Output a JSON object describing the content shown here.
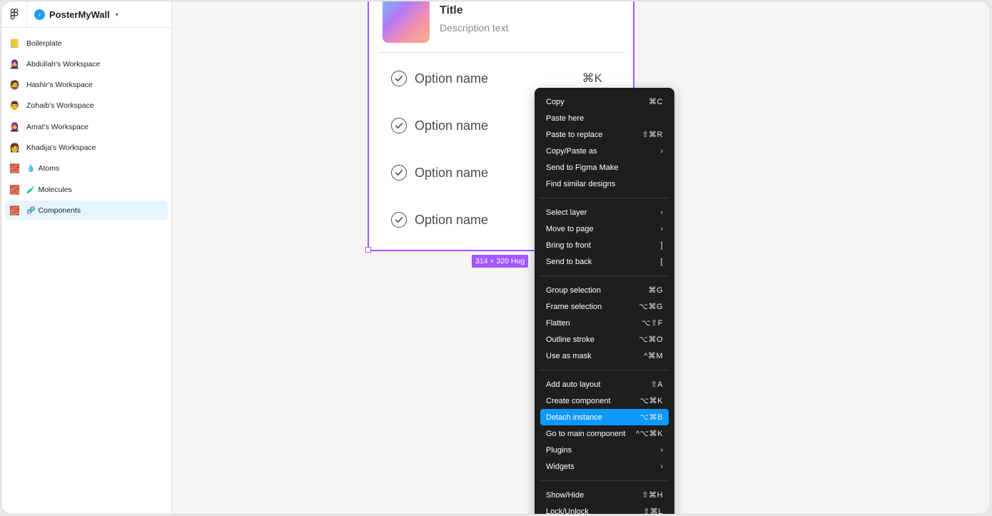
{
  "sidebar": {
    "team_name": "PosterMyWall",
    "items": [
      {
        "icon": "📒",
        "label": "Boilerplate"
      },
      {
        "icon": "🧕",
        "label": "Abdullah's Workspace"
      },
      {
        "icon": "🧔",
        "label": "Hashir's Workspace"
      },
      {
        "icon": "👨",
        "label": "Zohaib's Workspace"
      },
      {
        "icon": "🧕",
        "label": "Amat's Workspace"
      },
      {
        "icon": "👩",
        "label": "Khadija's Workspace"
      },
      {
        "icon": "🧱",
        "sub": "💧",
        "label": "Atoms"
      },
      {
        "icon": "🧱",
        "sub": "🧪",
        "label": "Molecules"
      },
      {
        "icon": "🧱",
        "sub": "🧬",
        "label": "Components"
      }
    ]
  },
  "card": {
    "title": "Title",
    "description": "Description text",
    "options": [
      {
        "label": "Option name",
        "shortcut": "⌘K"
      },
      {
        "label": "Option name",
        "shortcut": ""
      },
      {
        "label": "Option name",
        "shortcut": ""
      },
      {
        "label": "Option name",
        "shortcut": ""
      }
    ]
  },
  "size_badge": "314 × 320 Hug",
  "menu": {
    "items": [
      {
        "label": "Copy",
        "shortcut": "⌘C"
      },
      {
        "label": "Paste here",
        "shortcut": ""
      },
      {
        "label": "Paste to replace",
        "shortcut": "⇧⌘R"
      },
      {
        "label": "Copy/Paste as",
        "shortcut": "›"
      },
      {
        "label": "Send to Figma Make",
        "shortcut": ""
      },
      {
        "label": "Find similar designs",
        "shortcut": ""
      },
      {
        "label": "Select layer",
        "shortcut": "›"
      },
      {
        "label": "Move to page",
        "shortcut": "›"
      },
      {
        "label": "Bring to front",
        "shortcut": "]"
      },
      {
        "label": "Send to back",
        "shortcut": "["
      },
      {
        "label": "Group selection",
        "shortcut": "⌘G"
      },
      {
        "label": "Frame selection",
        "shortcut": "⌥⌘G"
      },
      {
        "label": "Flatten",
        "shortcut": "⌥⇧F"
      },
      {
        "label": "Outline stroke",
        "shortcut": "⌥⌘O"
      },
      {
        "label": "Use as mask",
        "shortcut": "^⌘M"
      },
      {
        "label": "Add auto layout",
        "shortcut": "⇧A"
      },
      {
        "label": "Create component",
        "shortcut": "⌥⌘K"
      },
      {
        "label": "Detach instance",
        "shortcut": "⌥⌘B"
      },
      {
        "label": "Go to main component",
        "shortcut": "^⌥⌘K"
      },
      {
        "label": "Plugins",
        "shortcut": "›"
      },
      {
        "label": "Widgets",
        "shortcut": "›"
      },
      {
        "label": "Show/Hide",
        "shortcut": "⇧⌘H"
      },
      {
        "label": "Lock/Unlock",
        "shortcut": "⇧⌘L"
      }
    ]
  },
  "colors": {
    "selection": "#a259ff",
    "menu_bg": "#1e1e1e",
    "menu_highlight": "#0d99ff",
    "sidebar_active": "#e5f4ff"
  }
}
